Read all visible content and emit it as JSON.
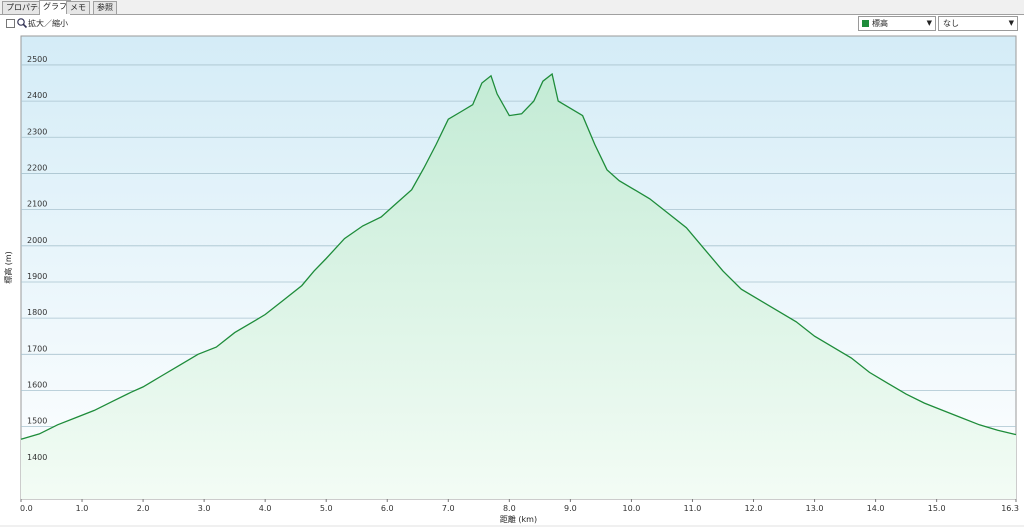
{
  "tabs": [
    {
      "label": "プロパティ",
      "active": false
    },
    {
      "label": "グラフ",
      "active": true
    },
    {
      "label": "メモ",
      "active": false
    },
    {
      "label": "参照",
      "active": false
    }
  ],
  "toolbar": {
    "zoom_label": "拡大／縮小",
    "series_select": {
      "selected": "標高",
      "color": "#1e8c3a"
    },
    "compare_select": {
      "selected": "なし"
    }
  },
  "chart_data": {
    "type": "area",
    "xlabel": "距離 (km)",
    "ylabel": "標高 (m)",
    "xlim": [
      0,
      16.3
    ],
    "ylim": [
      1300,
      2580
    ],
    "xticks": [
      "0.0",
      "1.0",
      "2.0",
      "3.0",
      "4.0",
      "5.0",
      "6.0",
      "7.0",
      "8.0",
      "9.0",
      "10.0",
      "11.0",
      "12.0",
      "13.0",
      "14.0",
      "15.0",
      "16.3"
    ],
    "yticks": [
      "1400",
      "1500",
      "1600",
      "1700",
      "1800",
      "1900",
      "2000",
      "2100",
      "2200",
      "2300",
      "2400",
      "2500"
    ],
    "grid": true,
    "series": [
      {
        "color": "#1e8c3a",
        "x": [
          0.0,
          0.3,
          0.6,
          0.9,
          1.2,
          1.5,
          1.8,
          2.0,
          2.3,
          2.6,
          2.9,
          3.2,
          3.5,
          3.8,
          4.0,
          4.3,
          4.6,
          4.8,
          5.0,
          5.3,
          5.6,
          5.9,
          6.1,
          6.4,
          6.6,
          6.8,
          7.0,
          7.2,
          7.4,
          7.55,
          7.7,
          7.8,
          8.0,
          8.2,
          8.4,
          8.55,
          8.7,
          8.8,
          9.0,
          9.2,
          9.4,
          9.6,
          9.8,
          10.0,
          10.3,
          10.6,
          10.9,
          11.2,
          11.5,
          11.8,
          12.1,
          12.4,
          12.7,
          13.0,
          13.3,
          13.6,
          13.9,
          14.2,
          14.5,
          14.8,
          15.1,
          15.4,
          15.7,
          16.0,
          16.3
        ],
        "y": [
          1465,
          1480,
          1505,
          1525,
          1545,
          1570,
          1595,
          1610,
          1640,
          1670,
          1700,
          1720,
          1760,
          1790,
          1810,
          1850,
          1890,
          1930,
          1965,
          2020,
          2055,
          2080,
          2110,
          2155,
          2215,
          2280,
          2350,
          2370,
          2390,
          2450,
          2470,
          2420,
          2360,
          2365,
          2400,
          2455,
          2475,
          2400,
          2380,
          2360,
          2280,
          2210,
          2180,
          2160,
          2130,
          2090,
          2050,
          1990,
          1930,
          1880,
          1850,
          1820,
          1790,
          1750,
          1720,
          1690,
          1650,
          1620,
          1590,
          1565,
          1545,
          1525,
          1505,
          1490,
          1478
        ]
      }
    ]
  }
}
